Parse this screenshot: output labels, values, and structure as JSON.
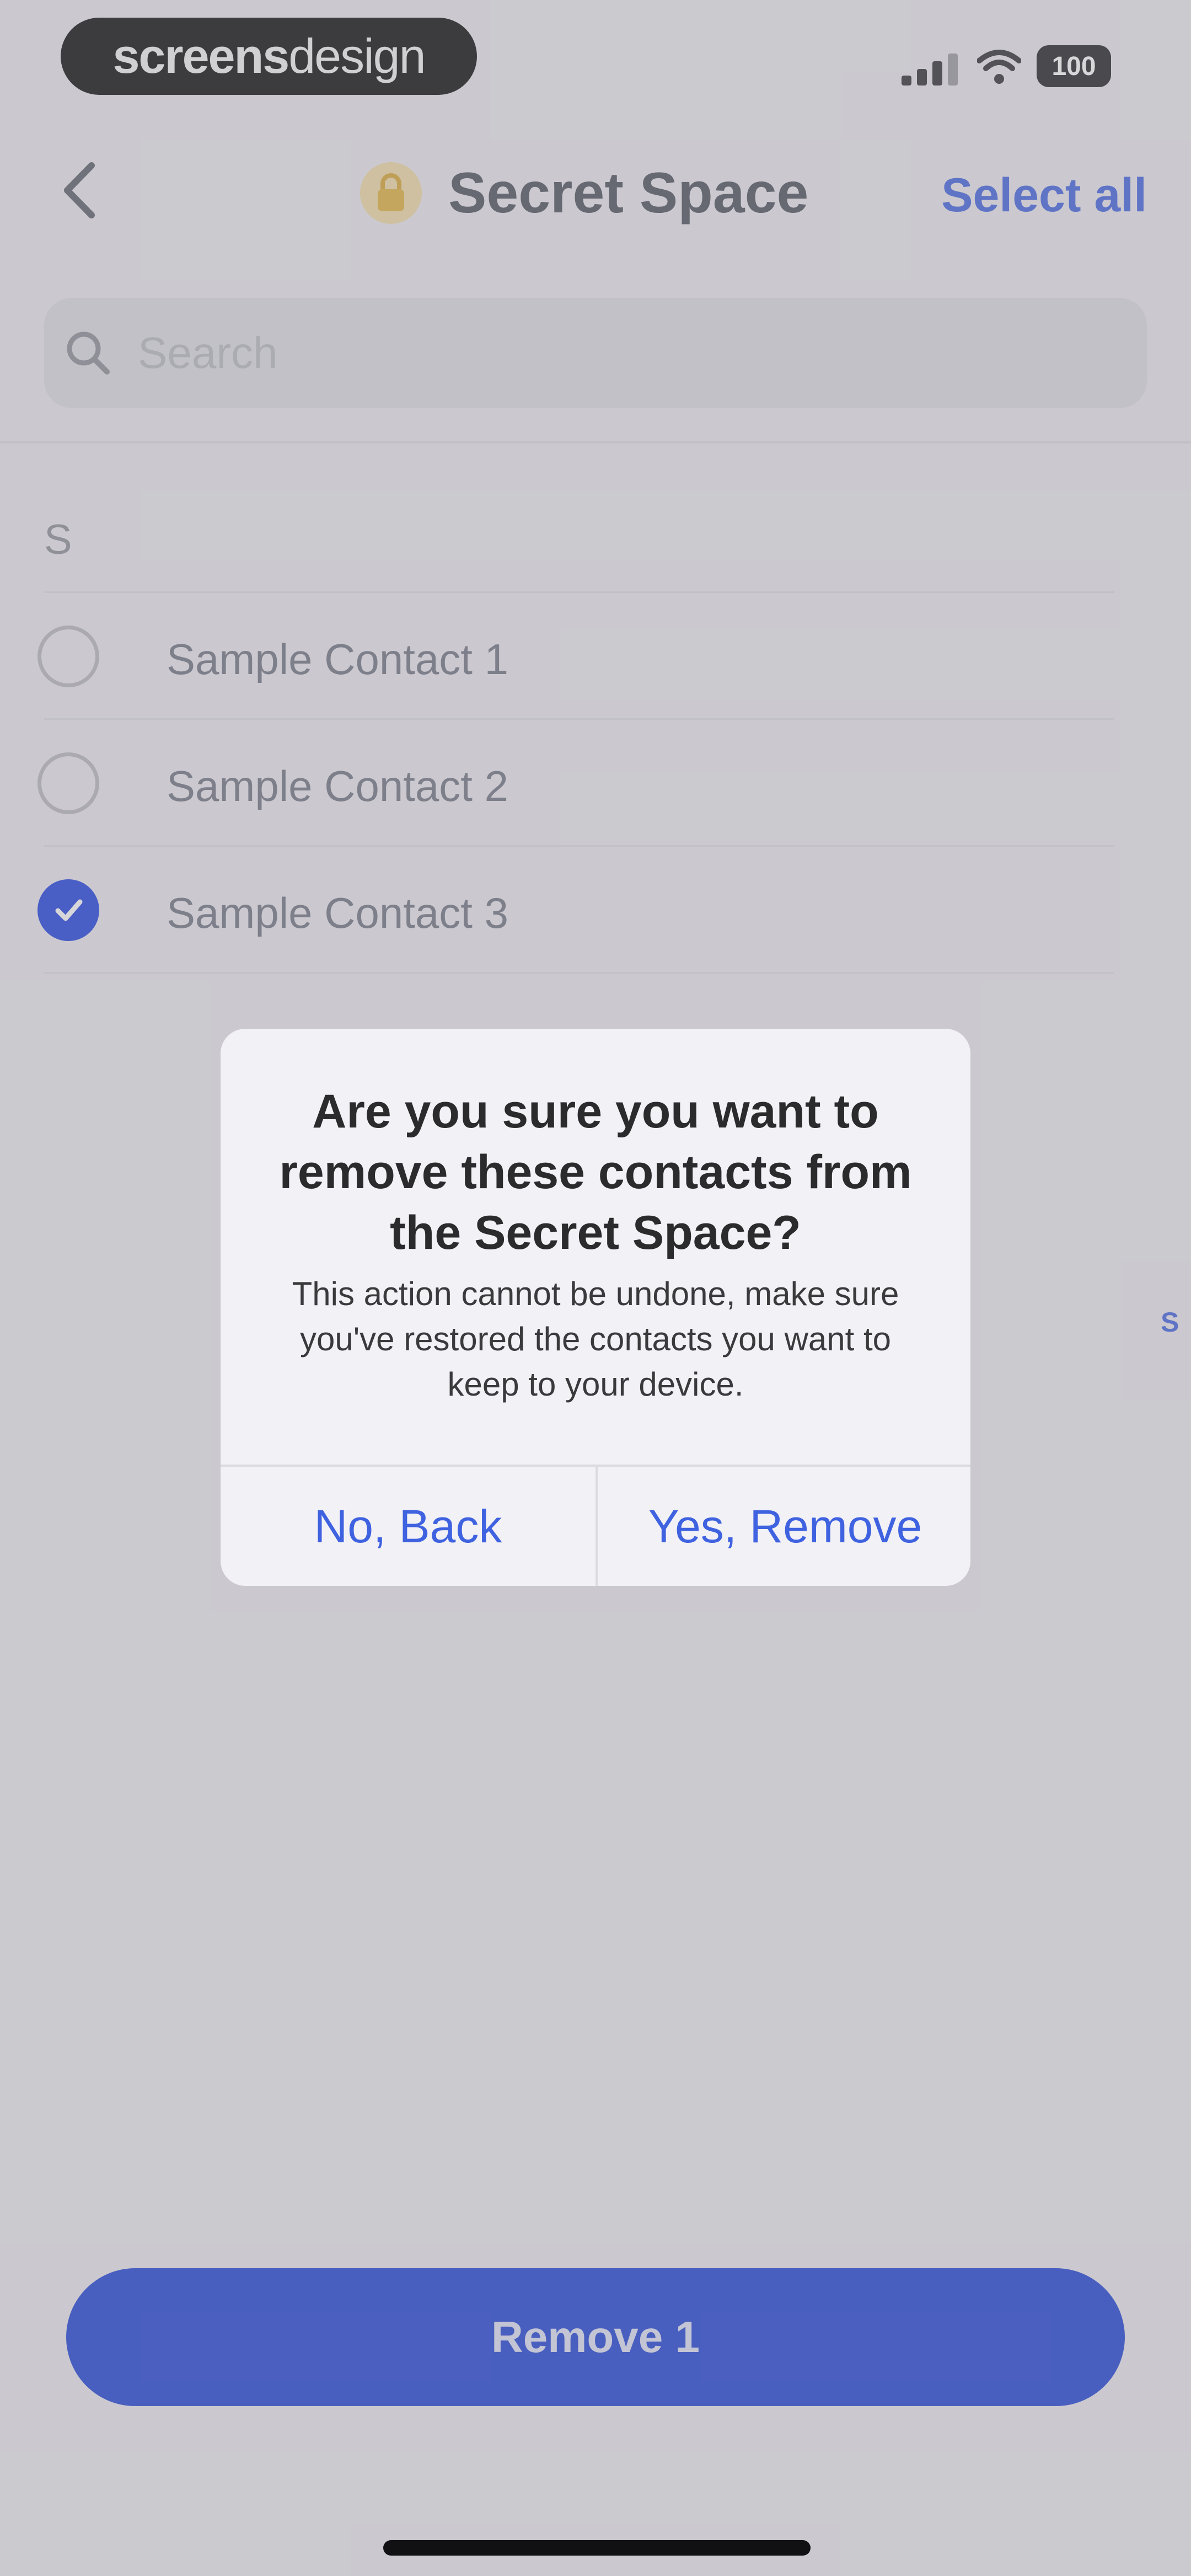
{
  "status_bar": {
    "brand_bold": "screens",
    "brand_light": "design",
    "battery": "100"
  },
  "nav": {
    "title": "Secret Space",
    "select_all": "Select all"
  },
  "search": {
    "placeholder": "Search"
  },
  "list": {
    "section": "S",
    "index_letter": "S",
    "contacts": [
      {
        "name": "Sample Contact 1",
        "selected": false
      },
      {
        "name": "Sample Contact 2",
        "selected": false
      },
      {
        "name": "Sample Contact 3",
        "selected": true
      }
    ]
  },
  "alert": {
    "title": "Are you sure you want to remove these contacts from the Secret Space?",
    "message": "This action cannot be undone, make sure you've restored the contacts you want to keep to your device.",
    "cancel_label": "No, Back",
    "confirm_label": "Yes, Remove"
  },
  "footer": {
    "remove_label": "Remove 1"
  },
  "colors": {
    "accent": "#1b3fd6",
    "link": "#3f62e0",
    "lock_gold": "#e0b23a"
  },
  "icons": [
    "back-chevron-icon",
    "lock-icon",
    "search-icon",
    "signal-icon",
    "wifi-icon",
    "battery-icon",
    "checkmark-icon"
  ]
}
